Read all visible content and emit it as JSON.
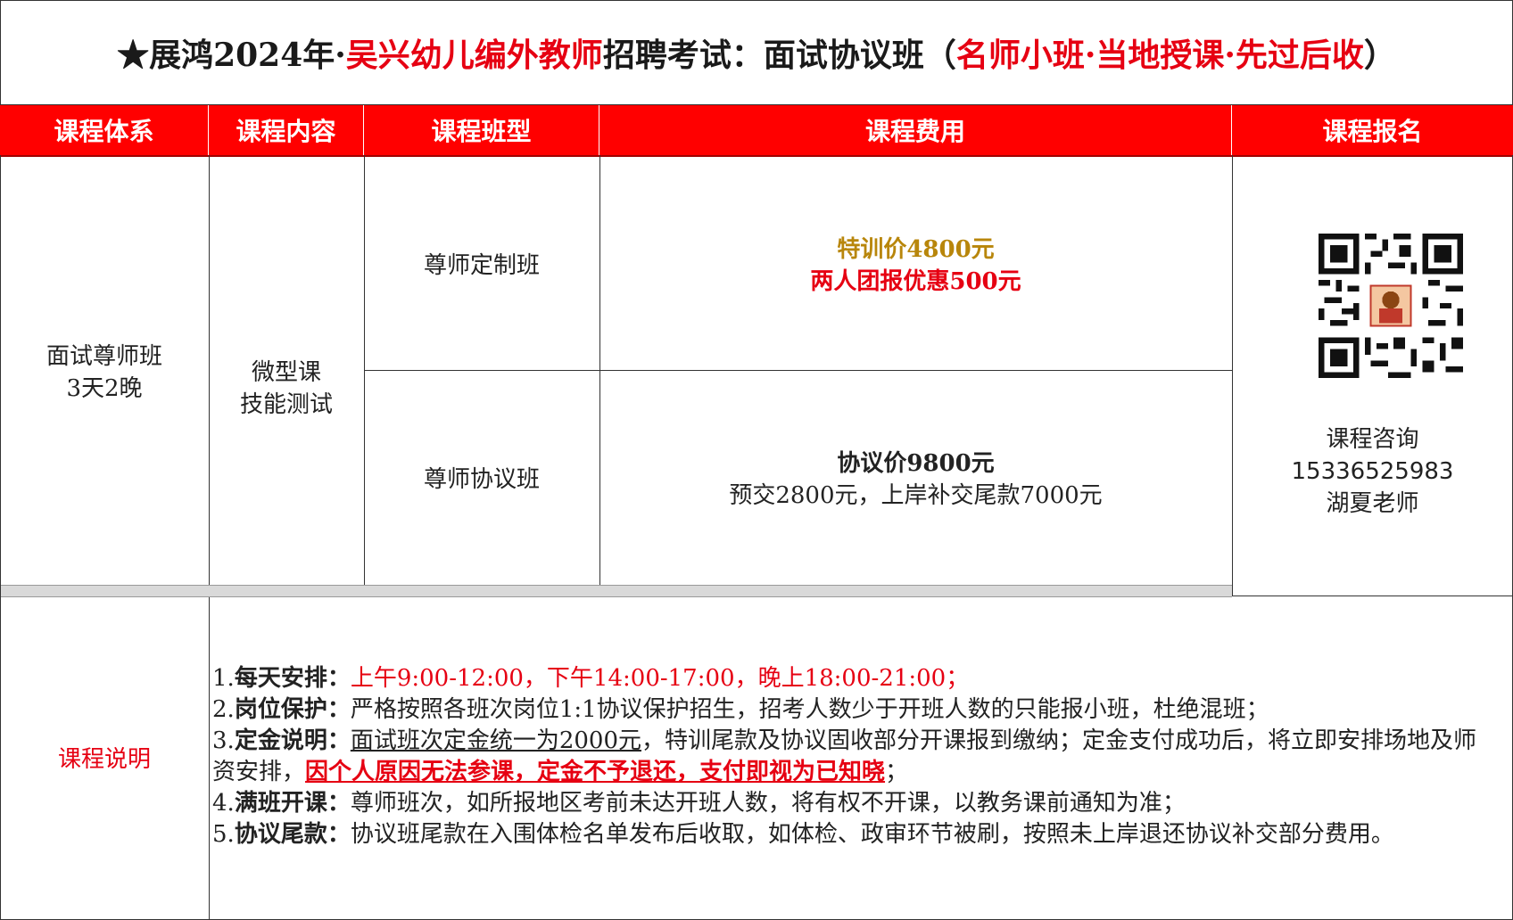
{
  "title": {
    "part1": "★展鸿2024年·",
    "part2": "吴兴幼儿编外教师",
    "part3": "招聘考试：面试协议班（",
    "part4": "名师小班·当地授课·先过后收",
    "part5": "）"
  },
  "headers": [
    "课程体系",
    "课程内容",
    "课程班型",
    "课程费用",
    "课程报名"
  ],
  "system": {
    "line1": "面试尊师班",
    "line2": "3天2晚"
  },
  "content": {
    "line1": "微型课",
    "line2": "技能测试"
  },
  "classes": [
    {
      "name": "尊师定制班",
      "fee_line1": "特训价4800元",
      "fee_line2": "两人团报优惠500元"
    },
    {
      "name": "尊师协议班",
      "fee_line1": "协议价9800元",
      "fee_line2": "预交2800元，上岸补交尾款7000元"
    }
  ],
  "signup": {
    "line1": "课程咨询",
    "phone": "15336525983",
    "teacher": "湖夏老师"
  },
  "colors": {
    "red": "#e60012",
    "header_red": "#ff0000",
    "gold": "#b8860b"
  },
  "notes_label": "课程说明",
  "notes": [
    {
      "num": "1.",
      "lead": "每天安排：",
      "red": "上午9:00-12:00，下午14:00-17:00，晚上18:00-21:00；"
    },
    {
      "num": "2.",
      "lead": "岗位保护：",
      "text": "严格按照各班次岗位1:1协议保护招生，招考人数少于开班人数的只能报小班，杜绝混班；"
    },
    {
      "num": "3.",
      "lead": "定金说明：",
      "ul": "面试班次定金统一为2000元",
      "text": "，特训尾款及协议固收部分开课报到缴纳；定金支付成功后，将立即安排场地及师资安排，",
      "redb": "因个人原因无法参课，定金不予退还，支付即视为已知晓",
      "end": "；"
    },
    {
      "num": "4.",
      "lead": "满班开课：",
      "text": "尊师班次，如所报地区考前未达开班人数，将有权不开课，以教务课前通知为准；"
    },
    {
      "num": "5.",
      "lead": "协议尾款：",
      "text": "协议班尾款在入围体检名单发布后收取，如体检、政审环节被刷，按照未上岸退还协议补交部分费用。"
    }
  ]
}
